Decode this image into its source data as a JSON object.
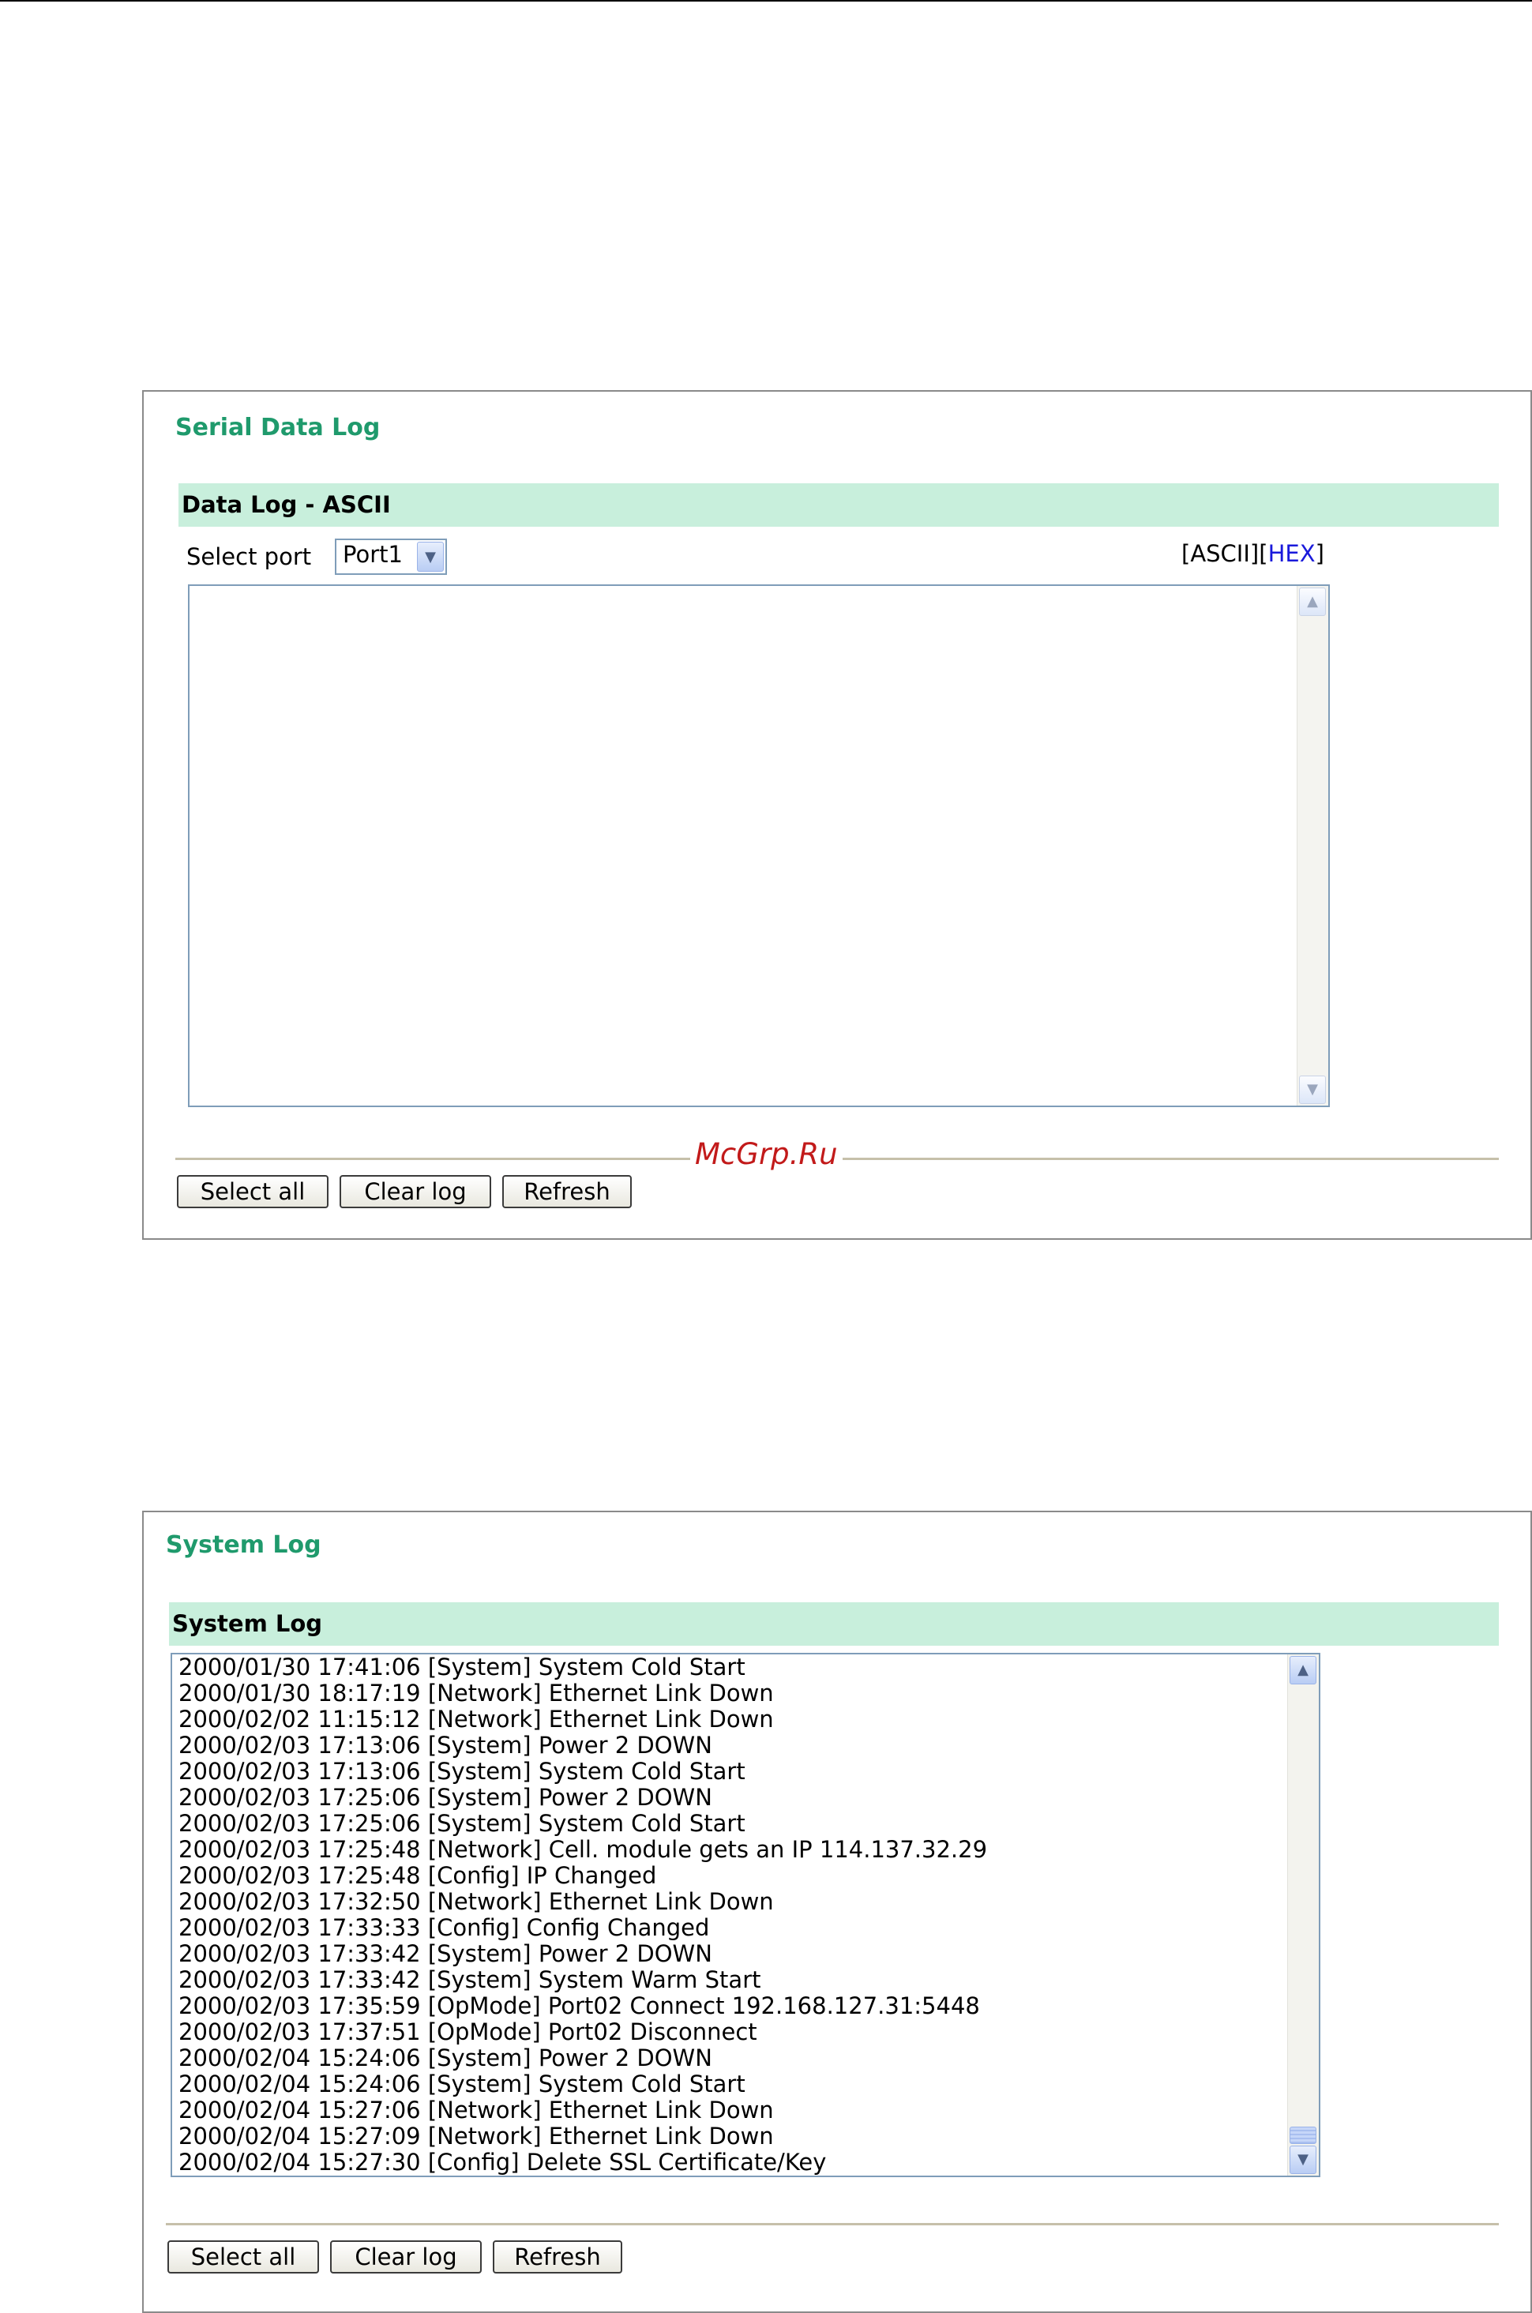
{
  "serial_panel": {
    "title": "Serial Data Log",
    "section_header": "Data Log - ASCII",
    "select_port_label": "Select port",
    "select_port_value": "Port1",
    "view_links": {
      "ascii": "[ASCII]",
      "hex_prefix": "[",
      "hex": "HEX",
      "hex_suffix": "]"
    },
    "log_text": "",
    "buttons": {
      "select_all": "Select all",
      "clear_log": "Clear log",
      "refresh": "Refresh"
    }
  },
  "system_panel": {
    "title": "System Log",
    "section_header": "System Log",
    "log_lines": [
      "2000/01/30 17:41:06 [System] System Cold Start",
      "2000/01/30 18:17:19 [Network] Ethernet Link Down",
      "2000/02/02 11:15:12 [Network] Ethernet Link Down",
      "2000/02/03 17:13:06 [System] Power 2 DOWN",
      "2000/02/03 17:13:06 [System] System Cold Start",
      "2000/02/03 17:25:06 [System] Power 2 DOWN",
      "2000/02/03 17:25:06 [System] System Cold Start",
      "2000/02/03 17:25:48 [Network] Cell. module gets an IP 114.137.32.29",
      "2000/02/03 17:25:48 [Config] IP Changed",
      "2000/02/03 17:32:50 [Network] Ethernet Link Down",
      "2000/02/03 17:33:33 [Config] Config Changed",
      "2000/02/03 17:33:42 [System] Power 2 DOWN",
      "2000/02/03 17:33:42 [System] System Warm Start",
      "2000/02/03 17:35:59 [OpMode] Port02 Connect 192.168.127.31:5448",
      "2000/02/03 17:37:51 [OpMode] Port02 Disconnect",
      "2000/02/04 15:24:06 [System] Power 2 DOWN",
      "2000/02/04 15:24:06 [System] System Cold Start",
      "2000/02/04 15:27:06 [Network] Ethernet Link Down",
      "2000/02/04 15:27:09 [Network] Ethernet Link Down",
      "2000/02/04 15:27:30 [Config] Delete SSL Certificate/Key"
    ],
    "buttons": {
      "select_all": "Select all",
      "clear_log": "Clear log",
      "refresh": "Refresh"
    }
  },
  "watermark": "McGrp.Ru",
  "icons": {
    "dropdown": "chevron-down-icon",
    "scroll_up": "scroll-up-arrow-icon",
    "scroll_down": "scroll-down-arrow-icon"
  },
  "colors": {
    "title_green": "#1f9a6c",
    "section_bar_bg": "#c8efdc",
    "link_blue": "#1a1adb",
    "watermark_red": "#c21a1a"
  }
}
